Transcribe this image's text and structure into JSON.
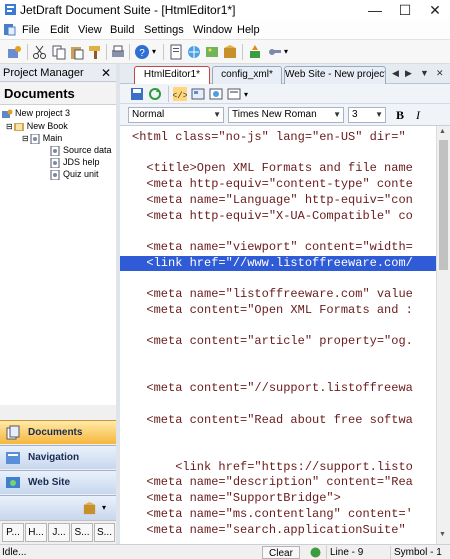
{
  "window": {
    "title": "JetDraft Document Suite - [HtmlEditor1*]",
    "minimize": "—",
    "maximize": "☐",
    "close": "✕"
  },
  "menu": {
    "items": [
      "File",
      "Edit",
      "View",
      "Build",
      "Settings",
      "Window",
      "Help"
    ]
  },
  "project_manager": {
    "header": "Project Manager",
    "close": "✕",
    "documents_title": "Documents",
    "tree": [
      {
        "label": "New project 3"
      },
      {
        "label": "New Book"
      },
      {
        "label": "Main"
      },
      {
        "label": "Source data"
      },
      {
        "label": "JDS help"
      },
      {
        "label": "Quiz unit"
      }
    ],
    "nav_buttons": [
      {
        "label": "Documents"
      },
      {
        "label": "Navigation"
      },
      {
        "label": "Web Site"
      }
    ],
    "bottom_tabs": [
      "P...",
      "H...",
      "J...",
      "S...",
      "S..."
    ]
  },
  "doc_tabs": [
    {
      "label": "HtmlEditor1*",
      "active": true
    },
    {
      "label": "config_xml*",
      "active": false
    },
    {
      "label": "Web Site - New project",
      "active": false
    }
  ],
  "doc_nav": {
    "prev": "◀",
    "next": "▶",
    "menu": "▼",
    "close": "✕"
  },
  "editor_toolbar": {
    "style_select": "Normal",
    "font_select": "Times New Roman",
    "size_select": "3",
    "bold": "B",
    "italic": "I"
  },
  "editor": {
    "lines": [
      "<html class=\"no-js\" lang=\"en-US\" dir=\"",
      "",
      "  <title>Open XML Formats and file name",
      "  <meta http-equiv=\"content-type\" conte",
      "  <meta name=\"Language\" http-equiv=\"con",
      "  <meta http-equiv=\"X-UA-Compatible\" co",
      "",
      "  <meta name=\"viewport\" content=\"width=",
      "  <link href=\"//www.listoffreeware.com/",
      "",
      "  <meta name=\"listoffreeware.com\" value",
      "  <meta content=\"Open XML Formats and :",
      "",
      "  <meta content=\"article\" property=\"og.",
      "",
      "",
      "  <meta content=\"//support.listoffreewa",
      "",
      "  <meta content=\"Read about free softwa",
      "",
      "",
      "      <link href=\"https://support.listo",
      "  <meta name=\"description\" content=\"Rea",
      "  <meta name=\"SupportBridge\">",
      "  <meta name=\"ms.contentlang\" content='",
      "  <meta name=\"search.applicationSuite\""
    ],
    "highlighted_line": 8
  },
  "statusbar": {
    "state": "Idle...",
    "clear": "Clear",
    "line": "Line - 9",
    "symbol": "Symbol - 1"
  }
}
